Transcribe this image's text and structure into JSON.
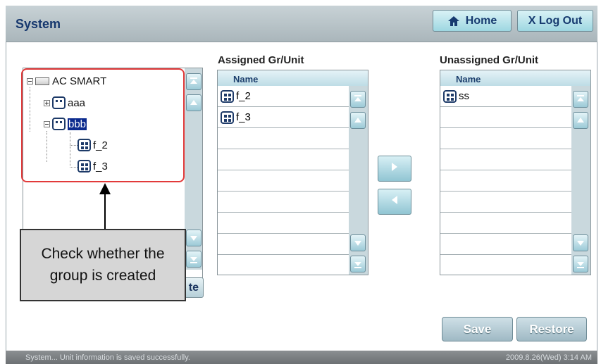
{
  "header": {
    "title": "System",
    "home_label": "Home",
    "logout_label": "X Log Out"
  },
  "tree": {
    "root": "AC SMART",
    "groups": [
      {
        "label": "aaa",
        "expanded": false
      },
      {
        "label": "bbb",
        "expanded": true,
        "selected": true,
        "children": [
          "f_2",
          "f_3"
        ]
      }
    ],
    "hidden_button_label": "te"
  },
  "assigned": {
    "label": "Assigned Gr/Unit",
    "column": "Name",
    "rows": [
      "f_2",
      "f_3"
    ]
  },
  "unassigned": {
    "label": "Unassigned Gr/Unit",
    "column": "Name",
    "rows": [
      "ss"
    ]
  },
  "actions": {
    "save": "Save",
    "restore": "Restore"
  },
  "callout": {
    "text": "Check whether the\ngroup is created"
  },
  "status": {
    "message": "System... Unit information is saved successfully.",
    "datetime": "2009.8.26(Wed)  3:14 AM"
  },
  "colors": {
    "accent": "#16386e",
    "highlight": "#e23a3a",
    "selection": "#0b2a8e"
  }
}
